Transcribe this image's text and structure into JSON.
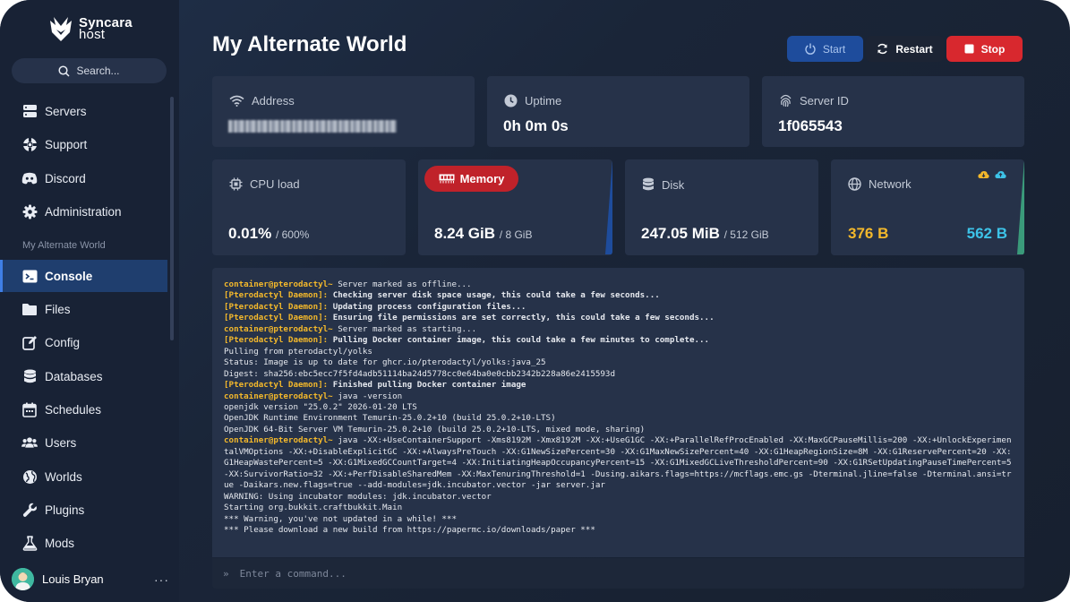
{
  "brand": {
    "line1": "Syncara",
    "line2": "host"
  },
  "search": {
    "label": "Search..."
  },
  "nav": {
    "main": [
      {
        "label": "Servers",
        "icon": "servers-icon"
      },
      {
        "label": "Support",
        "icon": "support-icon"
      },
      {
        "label": "Discord",
        "icon": "discord-icon"
      },
      {
        "label": "Administration",
        "icon": "gear-icon"
      }
    ],
    "section_label": "My Alternate World",
    "server": [
      {
        "label": "Console",
        "icon": "terminal-icon",
        "active": true
      },
      {
        "label": "Files",
        "icon": "folder-icon"
      },
      {
        "label": "Config",
        "icon": "edit-icon"
      },
      {
        "label": "Databases",
        "icon": "database-icon"
      },
      {
        "label": "Schedules",
        "icon": "calendar-icon"
      },
      {
        "label": "Users",
        "icon": "users-icon"
      },
      {
        "label": "Worlds",
        "icon": "globe-icon"
      },
      {
        "label": "Plugins",
        "icon": "wrench-icon"
      },
      {
        "label": "Mods",
        "icon": "flask-icon"
      }
    ]
  },
  "user": {
    "name": "Louis Bryan",
    "more": "···"
  },
  "header": {
    "title": "My Alternate World"
  },
  "controls": {
    "start": "Start",
    "restart": "Restart",
    "stop": "Stop"
  },
  "stats": {
    "address": {
      "label": "Address"
    },
    "uptime": {
      "label": "Uptime",
      "value": "0h 0m 0s"
    },
    "server_id": {
      "label": "Server ID",
      "value": "1f065543"
    },
    "cpu": {
      "label": "CPU load",
      "value": "0.01%",
      "limit": "/ 600%"
    },
    "memory": {
      "label": "Memory",
      "value": "8.24 GiB",
      "limit": "/ 8 GiB"
    },
    "disk": {
      "label": "Disk",
      "value": "247.05 MiB",
      "limit": "/ 512 GiB"
    },
    "network": {
      "label": "Network",
      "inbound": "376 B",
      "outbound": "562 B"
    }
  },
  "colors": {
    "accent": "#3f7fe6",
    "stop": "#d8282e",
    "memory_alert": "#c0222a",
    "net_in": "#f3b82b",
    "net_out": "#3dc3e8",
    "prompt": "#f3b82b"
  },
  "console": {
    "lines": [
      {
        "prefix": "container@pterodactyl~",
        "text": " Server marked as offline..."
      },
      {
        "prefix": "[Pterodactyl Daemon]:",
        "text": " Checking server disk space usage, this could take a few seconds...",
        "bold": true
      },
      {
        "prefix": "[Pterodactyl Daemon]:",
        "text": " Updating process configuration files...",
        "bold": true
      },
      {
        "prefix": "[Pterodactyl Daemon]:",
        "text": " Ensuring file permissions are set correctly, this could take a few seconds...",
        "bold": true
      },
      {
        "prefix": "container@pterodactyl~",
        "text": " Server marked as starting..."
      },
      {
        "prefix": "[Pterodactyl Daemon]:",
        "text": " Pulling Docker container image, this could take a few minutes to complete...",
        "bold": true
      },
      {
        "prefix": "",
        "text": "Pulling from pterodactyl/yolks"
      },
      {
        "prefix": "",
        "text": "Status: Image is up to date for ghcr.io/pterodactyl/yolks:java_25"
      },
      {
        "prefix": "",
        "text": "Digest: sha256:ebc5ecc7f5fd4adb51114ba24d5778cc0e64ba0e0cbb2342b228a86e2415593d"
      },
      {
        "prefix": "[Pterodactyl Daemon]:",
        "text": " Finished pulling Docker container image",
        "bold": true
      },
      {
        "prefix": "container@pterodactyl~",
        "text": " java -version"
      },
      {
        "prefix": "",
        "text": "openjdk version \"25.0.2\" 2026-01-20 LTS"
      },
      {
        "prefix": "",
        "text": "OpenJDK Runtime Environment Temurin-25.0.2+10 (build 25.0.2+10-LTS)"
      },
      {
        "prefix": "",
        "text": "OpenJDK 64-Bit Server VM Temurin-25.0.2+10 (build 25.0.2+10-LTS, mixed mode, sharing)"
      },
      {
        "prefix": "container@pterodactyl~",
        "text": " java -XX:+UseContainerSupport -Xms8192M -Xmx8192M -XX:+UseG1GC -XX:+ParallelRefProcEnabled -XX:MaxGCPauseMillis=200 -XX:+UnlockExperimentalVMOptions -XX:+DisableExplicitGC -XX:+AlwaysPreTouch -XX:G1NewSizePercent=30 -XX:G1MaxNewSizePercent=40 -XX:G1HeapRegionSize=8M -XX:G1ReservePercent=20 -XX:G1HeapWastePercent=5 -XX:G1MixedGCCountTarget=4 -XX:InitiatingHeapOccupancyPercent=15 -XX:G1MixedGCLiveThresholdPercent=90 -XX:G1RSetUpdatingPauseTimePercent=5 -XX:SurvivorRatio=32 -XX:+PerfDisableSharedMem -XX:MaxTenuringThreshold=1 -Dusing.aikars.flags=https://mcflags.emc.gs -Dterminal.jline=false -Dterminal.ansi=true -Daikars.new.flags=true --add-modules=jdk.incubator.vector -jar server.jar"
      },
      {
        "prefix": "",
        "text": "WARNING: Using incubator modules: jdk.incubator.vector"
      },
      {
        "prefix": "",
        "text": "Starting org.bukkit.craftbukkit.Main"
      },
      {
        "prefix": "",
        "text": "*** Warning, you've not updated in a while! ***"
      },
      {
        "prefix": "",
        "text": "*** Please download a new build from https://papermc.io/downloads/paper ***"
      }
    ],
    "input_prompt": "»",
    "input_placeholder": "Enter a command..."
  }
}
